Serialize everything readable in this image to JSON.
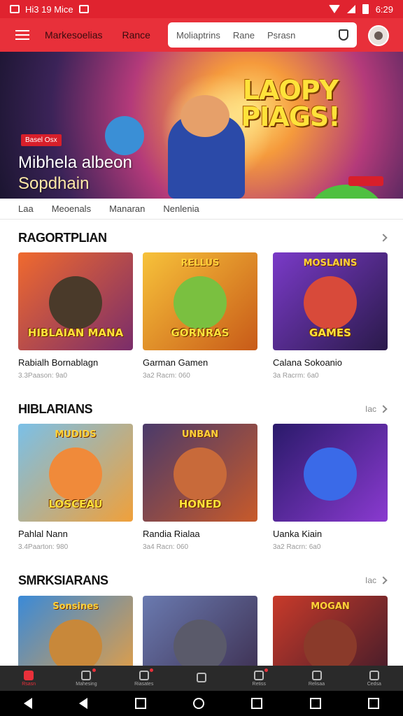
{
  "status_bar": {
    "time_left": "Hi3 19 Mice",
    "time_right": "6:29"
  },
  "header": {
    "brand": "Markesoelias",
    "link": "Rance",
    "search": {
      "items": [
        "Moliaptrins",
        "Rane",
        "Psrasn"
      ]
    }
  },
  "hero": {
    "logo": "LAOPY PIAGS!",
    "badge": "Basel Osx",
    "title_line1": "Mibhela albeon",
    "title_line2": "Sopdhain"
  },
  "filter_tabs": [
    "Laa",
    "Meoenals",
    "Manaran",
    "Nenlenia"
  ],
  "sections": [
    {
      "title": "RAGORTPLIAN",
      "more": "",
      "cards": [
        {
          "name": "Rabialh Bornablagn",
          "meta": "3.3Paason: 9a0",
          "top": "",
          "label": "HIBLAIAN MANA",
          "bg": "linear-gradient(135deg,#f06a2e,#7a2d6a)",
          "mascot": "#4a3a2a"
        },
        {
          "name": "Garman Gamen",
          "meta": "3a2 Racm: 060",
          "top": "RELLUS",
          "label": "GORNRAS",
          "bg": "linear-gradient(135deg,#f7c23a,#c85a18)",
          "mascot": "#7ac040"
        },
        {
          "name": "Calana Sokoanio",
          "meta": "3a Racrm: 6a0",
          "top": "MOSLAINS",
          "label": "GAMES",
          "bg": "linear-gradient(135deg,#7a3ac8,#2a1a4a)",
          "mascot": "#d84a3a"
        }
      ]
    },
    {
      "title": "HIBLARIANS",
      "more": "Iac",
      "cards": [
        {
          "name": "Pahlal Nann",
          "meta": "3.4Paarton: 980",
          "top": "MUDIDS",
          "label": "LOSCEAU",
          "bg": "linear-gradient(135deg,#7ac0e8,#f0a03a)",
          "mascot": "#f08a3a"
        },
        {
          "name": "Randia Rialaa",
          "meta": "3a4 Racn: 060",
          "top": "UNBAN",
          "label": "HONED",
          "bg": "linear-gradient(135deg,#4a3a6a,#c85a2a)",
          "mascot": "#c86a3a"
        },
        {
          "name": "Uanka Kiain",
          "meta": "3a2 Racrn: 6a0",
          "top": "",
          "label": "",
          "bg": "linear-gradient(135deg,#2a1a6a,#8a3ad0)",
          "mascot": "#3a6ae8"
        }
      ]
    },
    {
      "title": "SMRKSIARANS",
      "more": "Iac",
      "cards": [
        {
          "name": "",
          "meta": "",
          "top": "Sonsines",
          "label": "",
          "bg": "linear-gradient(135deg,#3a8ad8,#f0a03a)",
          "mascot": "#c8883a"
        },
        {
          "name": "",
          "meta": "",
          "top": "",
          "label": "",
          "bg": "linear-gradient(135deg,#6a7ab0,#3a2a4a)",
          "mascot": "#5a5a6a"
        },
        {
          "name": "",
          "meta": "",
          "top": "MOGAN",
          "label": "",
          "bg": "linear-gradient(135deg,#c83a2a,#3a1a2a)",
          "mascot": "#8a3a2a"
        }
      ]
    }
  ],
  "bottom_nav": [
    {
      "label": "Rsasn",
      "active": true,
      "dot": false
    },
    {
      "label": "Mahesing",
      "active": false,
      "dot": true
    },
    {
      "label": "Riasates",
      "active": false,
      "dot": true
    },
    {
      "label": "",
      "active": false,
      "dot": false
    },
    {
      "label": "Retiss",
      "active": false,
      "dot": true
    },
    {
      "label": "Relisaa",
      "active": false,
      "dot": false
    },
    {
      "label": "Cedsa",
      "active": false,
      "dot": false
    }
  ],
  "colors": {
    "primary": "#e8303a",
    "status": "#e0232f"
  }
}
